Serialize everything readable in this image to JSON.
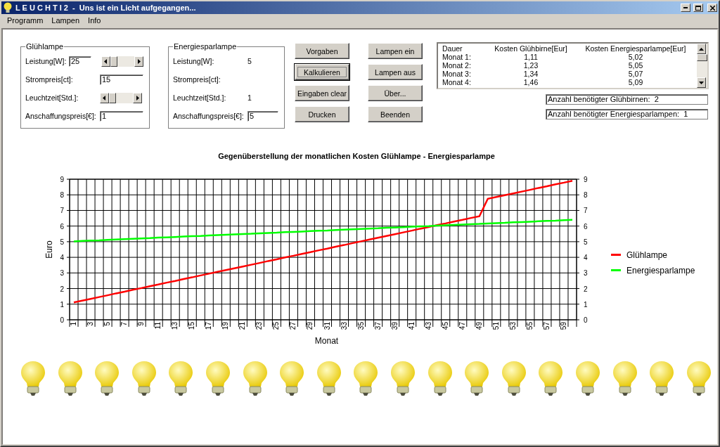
{
  "window": {
    "title": "L E U C H T I 2  -  Uns ist ein Licht aufgegangen..."
  },
  "menu": [
    "Programm",
    "Lampen",
    "Info"
  ],
  "groups": [
    {
      "title": "Glühlampe",
      "rows": [
        {
          "kind": "input",
          "label": "Leistung[W]:",
          "value": "25",
          "slider": {
            "level": 0
          }
        },
        {
          "kind": "input",
          "label": "Strompreis[ct]:",
          "value": "15"
        },
        {
          "kind": "slider",
          "label": "Leuchtzeit[Std.]:",
          "slider": {
            "level": 0
          }
        },
        {
          "kind": "input",
          "label": "Anschaffungspreis[€]:",
          "value": "1"
        }
      ]
    },
    {
      "title": "Energiesparlampe",
      "rows": [
        {
          "kind": "text",
          "label": "Leistung[W]:",
          "value": "5"
        },
        {
          "kind": "text",
          "label": "Strompreis[ct]:"
        },
        {
          "kind": "text",
          "label": "Leuchtzeit[Std.]:",
          "value": "1"
        },
        {
          "kind": "input",
          "label": "Anschaffungspreis[€]:",
          "value": "5"
        }
      ]
    }
  ],
  "buttons": [
    [
      {
        "label": "Vorgaben",
        "focused": false
      },
      {
        "label": "Kalkulieren",
        "focused": true
      },
      {
        "label": "Eingaben clear",
        "focused": false
      },
      {
        "label": "Drucken",
        "focused": false
      }
    ],
    [
      {
        "label": "Lampen ein",
        "focused": false
      },
      {
        "label": "Lampen aus",
        "focused": false
      },
      {
        "label": "Über...",
        "focused": false
      },
      {
        "label": "Beenden",
        "focused": false
      }
    ]
  ],
  "table": {
    "columns": [
      "Dauer",
      "Kosten Glühbirne[Eur]",
      "Kosten Energiesparlampe[Eur]"
    ],
    "rows": [
      [
        "Monat 1:",
        "1,11",
        "5,02"
      ],
      [
        "Monat 2:",
        "1,23",
        "5,05"
      ],
      [
        "Monat 3:",
        "1,34",
        "5,07"
      ],
      [
        "Monat 4:",
        "1,46",
        "5,09"
      ]
    ]
  },
  "readouts": [
    "Anzahl benötigter Glühbirnen:  2",
    "Anzahl benötigter Energiesparlampen:  1"
  ],
  "chart": {
    "chart_data": {
      "type": "line",
      "title": "Gegenüberstellung der monatlichen Kosten Glühlampe - Energiesparlampe",
      "xlabel": "Monat",
      "ylabel": "Euro",
      "x": [
        1,
        2,
        3,
        4,
        5,
        6,
        7,
        8,
        9,
        10,
        11,
        12,
        13,
        14,
        15,
        16,
        17,
        18,
        19,
        20,
        21,
        22,
        23,
        24,
        25,
        26,
        27,
        28,
        29,
        30,
        31,
        32,
        33,
        34,
        35,
        36,
        37,
        38,
        39,
        40,
        41,
        42,
        43,
        44,
        45,
        46,
        47,
        48,
        49,
        50,
        51,
        52,
        53,
        54,
        55,
        56,
        57,
        58,
        59,
        60
      ],
      "xticks": [
        {
          "value": 1,
          "label": "1"
        },
        {
          "value": 3,
          "label": "3"
        },
        {
          "value": 5,
          "label": "5"
        },
        {
          "value": 7,
          "label": "7"
        },
        {
          "value": 9,
          "label": "9"
        },
        {
          "value": 11,
          "label": "11"
        },
        {
          "value": 13,
          "label": "13"
        },
        {
          "value": 15,
          "label": "15"
        },
        {
          "value": 17,
          "label": "17"
        },
        {
          "value": 19,
          "label": "19"
        },
        {
          "value": 21,
          "label": "21"
        },
        {
          "value": 23,
          "label": "23"
        },
        {
          "value": 25,
          "label": "25"
        },
        {
          "value": 27,
          "label": "27"
        },
        {
          "value": 29,
          "label": "29"
        },
        {
          "value": 31,
          "label": "31"
        },
        {
          "value": 33,
          "label": "33"
        },
        {
          "value": 35,
          "label": "35"
        },
        {
          "value": 37,
          "label": "37"
        },
        {
          "value": 39,
          "label": "39"
        },
        {
          "value": 41,
          "label": "41"
        },
        {
          "value": 43,
          "label": "43"
        },
        {
          "value": 45,
          "label": "45"
        },
        {
          "value": 47,
          "label": "47"
        },
        {
          "value": 49,
          "label": "49"
        },
        {
          "value": 51,
          "label": "51"
        },
        {
          "value": 53,
          "label": "53"
        },
        {
          "value": 55,
          "label": "55"
        },
        {
          "value": 57,
          "label": "57"
        },
        {
          "value": 59,
          "label": "59"
        }
      ],
      "xlim": [
        0.5,
        60.5
      ],
      "ylim": [
        0,
        9
      ],
      "y2lim": [
        0,
        9
      ],
      "yticks": [
        {
          "value": 0,
          "label": "0"
        },
        {
          "value": 1,
          "label": "1"
        },
        {
          "value": 2,
          "label": "2"
        },
        {
          "value": 3,
          "label": "3"
        },
        {
          "value": 4,
          "label": "4"
        },
        {
          "value": 5,
          "label": "5"
        },
        {
          "value": 6,
          "label": "6"
        },
        {
          "value": 7,
          "label": "7"
        },
        {
          "value": 8,
          "label": "8"
        },
        {
          "value": 9,
          "label": "9"
        }
      ],
      "y2ticks": [
        {
          "value": 0,
          "label": "0"
        },
        {
          "value": 1,
          "label": "1"
        },
        {
          "value": 2,
          "label": "2"
        },
        {
          "value": 3,
          "label": "3"
        },
        {
          "value": 4,
          "label": "4"
        },
        {
          "value": 5,
          "label": "5"
        },
        {
          "value": 6,
          "label": "6"
        },
        {
          "value": 7,
          "label": "7"
        },
        {
          "value": 8,
          "label": "8"
        },
        {
          "value": 9,
          "label": "9"
        }
      ],
      "grid": true,
      "legend": true,
      "series": [
        {
          "name": "Glühlampe",
          "color": "#ff0000",
          "values": [
            1.11,
            1.23,
            1.34,
            1.46,
            1.57,
            1.69,
            1.8,
            1.92,
            2.03,
            2.15,
            2.26,
            2.38,
            2.49,
            2.61,
            2.72,
            2.84,
            2.95,
            3.07,
            3.18,
            3.3,
            3.41,
            3.53,
            3.64,
            3.76,
            3.87,
            3.99,
            4.1,
            4.22,
            4.33,
            4.45,
            4.56,
            4.68,
            4.79,
            4.91,
            5.02,
            5.14,
            5.25,
            5.37,
            5.48,
            5.6,
            5.71,
            5.83,
            5.94,
            6.06,
            6.17,
            6.29,
            6.4,
            6.52,
            6.63,
            7.75,
            7.86,
            7.98,
            8.09,
            8.21,
            8.32,
            8.44,
            8.55,
            8.67,
            8.78,
            8.9
          ]
        },
        {
          "name": "Energiesparlampe",
          "color": "#00ff00",
          "values": [
            5.02,
            5.05,
            5.07,
            5.09,
            5.12,
            5.14,
            5.16,
            5.19,
            5.21,
            5.23,
            5.26,
            5.28,
            5.3,
            5.33,
            5.35,
            5.37,
            5.4,
            5.42,
            5.44,
            5.47,
            5.49,
            5.51,
            5.54,
            5.56,
            5.58,
            5.61,
            5.63,
            5.65,
            5.68,
            5.7,
            5.72,
            5.75,
            5.77,
            5.79,
            5.82,
            5.84,
            5.86,
            5.89,
            5.91,
            5.93,
            5.96,
            5.98,
            6.0,
            6.03,
            6.05,
            6.07,
            6.1,
            6.12,
            6.14,
            6.17,
            6.19,
            6.21,
            6.24,
            6.26,
            6.28,
            6.31,
            6.33,
            6.35,
            6.38,
            6.4
          ]
        }
      ]
    }
  },
  "bulbs": [
    {
      "on": true
    },
    {
      "on": true
    },
    {
      "on": true
    },
    {
      "on": true
    },
    {
      "on": true
    },
    {
      "on": true
    },
    {
      "on": true
    },
    {
      "on": true
    },
    {
      "on": true
    },
    {
      "on": true
    },
    {
      "on": true
    },
    {
      "on": true
    },
    {
      "on": true
    },
    {
      "on": true
    },
    {
      "on": true
    },
    {
      "on": true
    },
    {
      "on": true
    },
    {
      "on": true
    },
    {
      "on": true
    }
  ]
}
